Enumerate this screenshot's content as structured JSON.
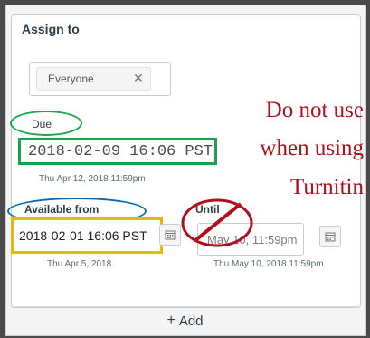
{
  "assign": {
    "label": "Assign to",
    "chip": "Everyone",
    "remove_icon": "close-icon",
    "remove_glyph": "✕"
  },
  "due": {
    "label": "Due",
    "value": "2018-02-09 16:06 PST",
    "sub": "Thu Apr 12, 2018 11:59pm"
  },
  "available_from": {
    "label": "Available from",
    "value": "2018-02-01 16:06 PST",
    "sub": "Thu Apr 5, 2018"
  },
  "until": {
    "label": "Until",
    "value": "May 10, 11:59pm",
    "sub": "Thu May 10, 2018 11:59pm"
  },
  "add": {
    "plus": "+",
    "label": "Add"
  },
  "annotation": {
    "line1": "Do not use",
    "line2": "when using",
    "line3": "Turnitin"
  },
  "colors": {
    "green": "#16a34a",
    "blue": "#0b67b0",
    "yellow": "#f3b400",
    "red": "#b20e1b"
  }
}
